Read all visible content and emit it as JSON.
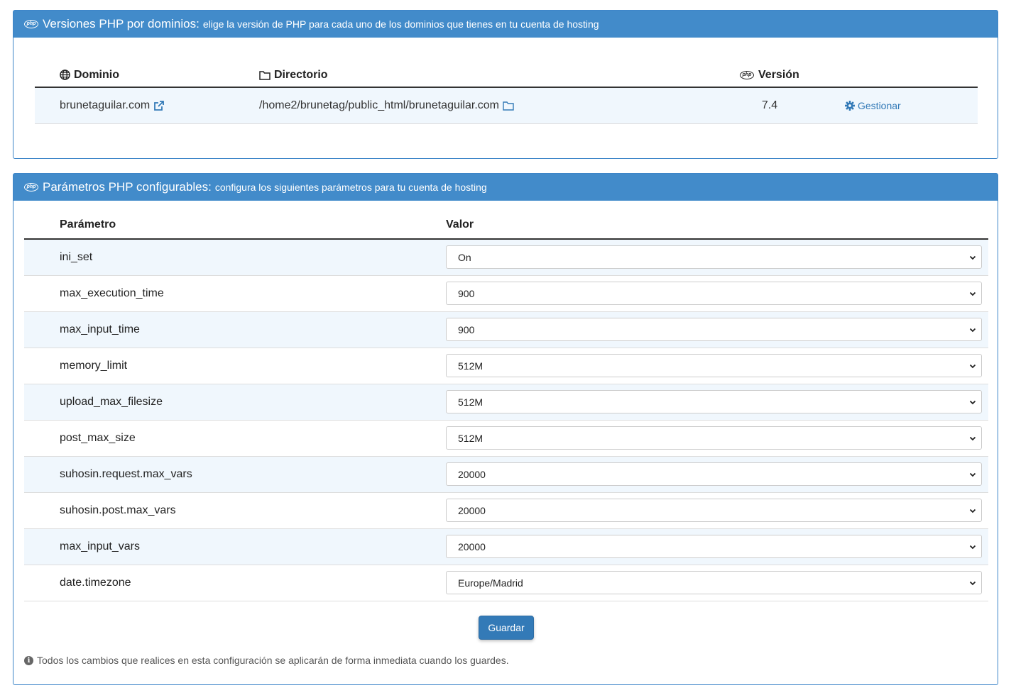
{
  "versions_panel": {
    "title": "Versiones PHP por dominios:",
    "subtitle": "elige la versión de PHP para cada uno de los dominios que tienes en tu cuenta de hosting",
    "headers": {
      "domain": "Dominio",
      "directory": "Directorio",
      "version": "Versión"
    },
    "rows": [
      {
        "domain": "brunetaguilar.com",
        "directory": "/home2/brunetag/public_html/brunetaguilar.com",
        "version": "7.4",
        "action": "Gestionar"
      }
    ]
  },
  "params_panel": {
    "title": "Parámetros PHP configurables:",
    "subtitle": "configura los siguientes parámetros para tu cuenta de hosting",
    "headers": {
      "param": "Parámetro",
      "value": "Valor"
    },
    "rows": [
      {
        "name": "ini_set",
        "value": "On"
      },
      {
        "name": "max_execution_time",
        "value": "900"
      },
      {
        "name": "max_input_time",
        "value": "900"
      },
      {
        "name": "memory_limit",
        "value": "512M"
      },
      {
        "name": "upload_max_filesize",
        "value": "512M"
      },
      {
        "name": "post_max_size",
        "value": "512M"
      },
      {
        "name": "suhosin.request.max_vars",
        "value": "20000"
      },
      {
        "name": "suhosin.post.max_vars",
        "value": "20000"
      },
      {
        "name": "max_input_vars",
        "value": "20000"
      },
      {
        "name": "date.timezone",
        "value": "Europe/Madrid"
      }
    ],
    "save_label": "Guardar",
    "note": "Todos los cambios que realices en esta configuración se aplicarán de forma inmediata cuando los guardes."
  },
  "colors": {
    "header_bg": "#428bca",
    "row_alt": "#f0f7fd",
    "button": "#337ab7",
    "link": "#337ab7"
  },
  "icons": [
    "php-icon",
    "globe-icon",
    "folder-icon",
    "external-link-icon",
    "gear-icon",
    "info-icon",
    "chevron-down-icon"
  ]
}
